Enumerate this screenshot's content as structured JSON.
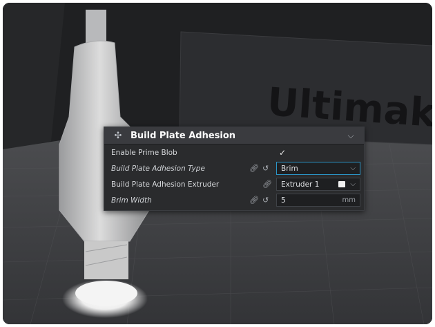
{
  "panel": {
    "title": "Build Plate Adhesion",
    "settings_icon": "settings-category-icon",
    "collapse_icon": "chevron-down-icon"
  },
  "rows": [
    {
      "label": "Enable Prime Blob",
      "checked": true
    },
    {
      "label": "Build Plate Adhesion Type",
      "value": "Brim"
    },
    {
      "label": "Build Plate Adhesion Extruder",
      "value": "Extruder 1",
      "color": "#f0f0f0"
    },
    {
      "label": "Brim Width",
      "value": "5",
      "unit": "mm"
    }
  ],
  "scene": {
    "backdrop_text": "Ultimak"
  },
  "colors": {
    "accent": "#2b95c7",
    "panel_bg": "#2a2b2d",
    "header_bg": "#3a3b3f"
  }
}
